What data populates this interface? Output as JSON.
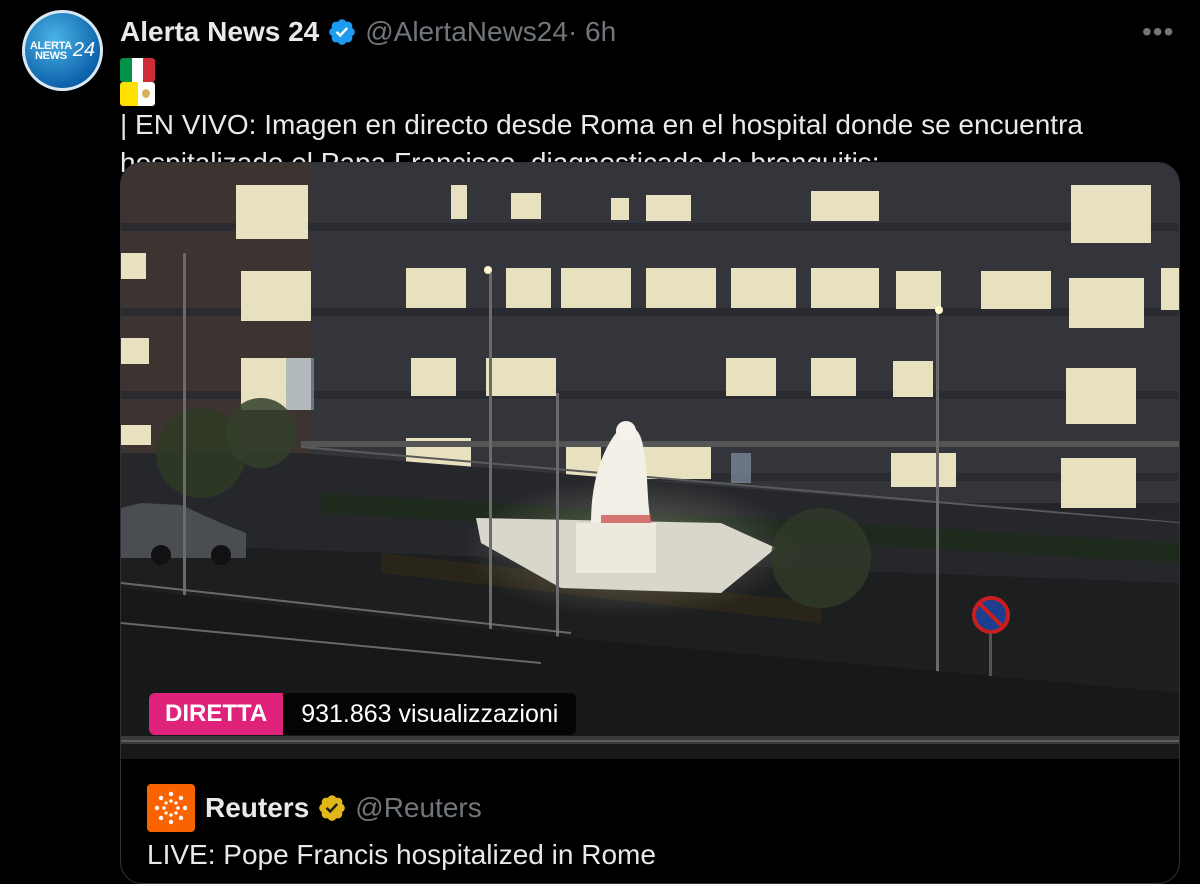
{
  "tweet": {
    "author_name": "Alerta News 24",
    "avatar_line1": "ALERTA",
    "avatar_line2": "NEWS",
    "avatar_number": "24",
    "handle": "@AlertaNews24",
    "time": " · 6h",
    "more_label": "•••",
    "text": "| EN VIVO: Imagen en directo desde Roma en el hospital donde se encuentra hospitalizado el Papa Francisco, diagnosticado de bronquitis:"
  },
  "media": {
    "live_label": "DIRETTA",
    "views": "931.863 visualizzazioni"
  },
  "quote": {
    "name": "Reuters",
    "handle": "@Reuters",
    "text": "LIVE: Pope Francis hospitalized in Rome"
  },
  "colors": {
    "background": "#000000",
    "live_badge": "#e0237a",
    "verified_blue": "#1d9bf0",
    "verified_gold": "#e2b719",
    "reuters_orange": "#fa6400"
  },
  "icons": [
    "verified-badge-icon",
    "more-icon",
    "italy-flag-icon",
    "vatican-flag-icon",
    "reuters-logo-icon"
  ]
}
